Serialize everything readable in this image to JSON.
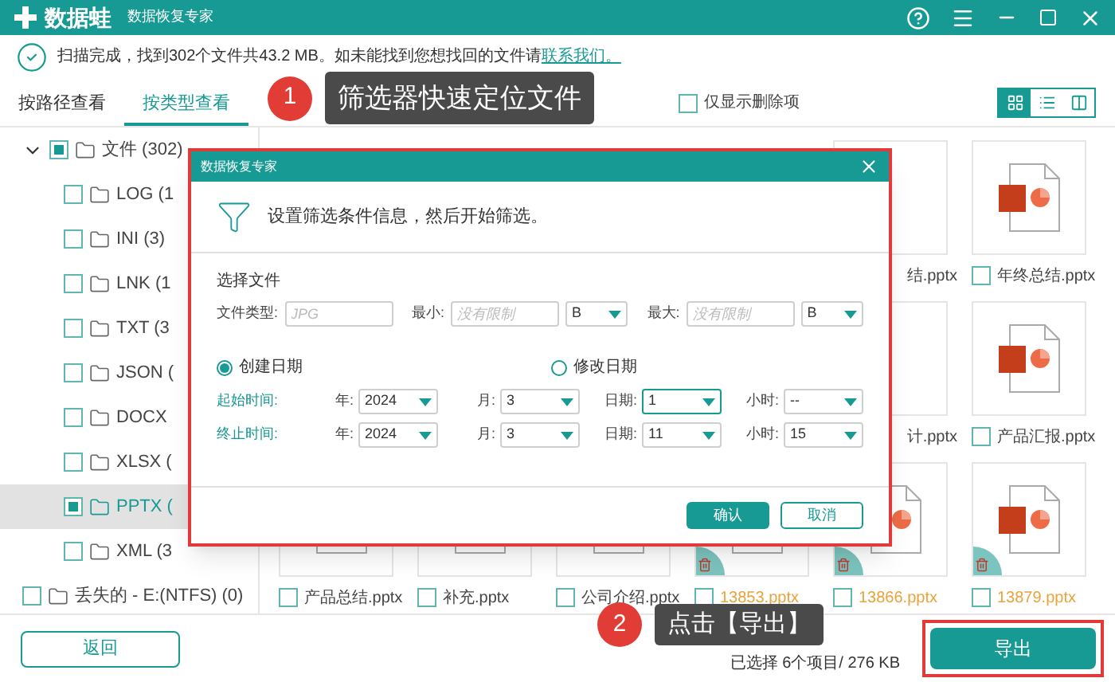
{
  "title_bar": {
    "logo_text": "数据蛙",
    "subtitle": "数据恢复专家"
  },
  "scan_status": {
    "text": "扫描完成，找到302个文件共43.2 MB。如未能找到您想找回的文件请",
    "link": "联系我们。"
  },
  "view_tabs": [
    {
      "label": "按路径查看",
      "selected": false
    },
    {
      "label": "按类型查看",
      "selected": true
    }
  ],
  "deleted_only": {
    "label": "仅显示删除项",
    "checked": false
  },
  "view_buttons": [
    {
      "kind": "grid",
      "selected": true
    },
    {
      "kind": "list",
      "selected": false
    },
    {
      "kind": "columns",
      "selected": false
    }
  ],
  "tree": [
    {
      "label": "文件 (302)",
      "partial": true,
      "expanded": true,
      "selected": false,
      "children": [
        {
          "label": "LOG (1",
          "partial": false,
          "selected": false
        },
        {
          "label": "INI (3)",
          "partial": false,
          "selected": false
        },
        {
          "label": "LNK (1",
          "partial": false,
          "selected": false
        },
        {
          "label": "TXT (3",
          "partial": false,
          "selected": false
        },
        {
          "label": "JSON (",
          "partial": false,
          "selected": false
        },
        {
          "label": "DOCX",
          "partial": false,
          "selected": false
        },
        {
          "label": "XLSX (",
          "partial": false,
          "selected": false
        },
        {
          "label": "PPTX (",
          "partial": true,
          "selected": true
        },
        {
          "label": "XML (3",
          "partial": false,
          "selected": false
        }
      ]
    },
    {
      "label": "丢失的 - E:(NTFS) (0)",
      "partial": false,
      "selected": false
    }
  ],
  "file_rows": [
    [
      {
        "name": "结.pptx",
        "deleted": false
      },
      {
        "name": "年终总结.pptx",
        "checked": false,
        "deleted": false
      }
    ],
    [
      {
        "name": "计.pptx",
        "deleted": false
      },
      {
        "name": "产品汇报.pptx",
        "checked": false,
        "deleted": false
      }
    ],
    [
      {
        "name": "产品总结.pptx",
        "checked": false,
        "deleted": false
      },
      {
        "name": "补充.pptx",
        "checked": false,
        "deleted": false
      },
      {
        "name": "公司介绍.pptx",
        "checked": false,
        "deleted": false
      },
      {
        "name": "13853.pptx",
        "checked": false,
        "deleted": true
      },
      {
        "name": "13866.pptx",
        "checked": false,
        "deleted": true
      },
      {
        "name": "13879.pptx",
        "checked": false,
        "deleted": true
      }
    ]
  ],
  "back_button": "返回",
  "selection_summary": "已选择 6个项目/ 276 KB",
  "export_button": "导出",
  "dialog": {
    "title": "数据恢复专家",
    "intro": "设置筛选条件信息，然后开始筛选。",
    "section": "选择文件",
    "file_type": {
      "label": "文件类型:",
      "placeholder": "JPG"
    },
    "min": {
      "label": "最小:",
      "placeholder": "没有限制",
      "unit": "B"
    },
    "max": {
      "label": "最大:",
      "placeholder": "没有限制",
      "unit": "B"
    },
    "date_modes": [
      {
        "label": "创建日期",
        "selected": true
      },
      {
        "label": "修改日期",
        "selected": false
      }
    ],
    "ranges": [
      {
        "label": "起始时间:",
        "fields": [
          {
            "label": "年:",
            "value": "2024",
            "focused": false
          },
          {
            "label": "月:",
            "value": "3",
            "focused": false
          },
          {
            "label": "日期:",
            "value": "1",
            "focused": true
          },
          {
            "label": "小时:",
            "value": "--",
            "focused": false
          }
        ]
      },
      {
        "label": "终止时间:",
        "fields": [
          {
            "label": "年:",
            "value": "2024",
            "focused": false
          },
          {
            "label": "月:",
            "value": "3",
            "focused": false
          },
          {
            "label": "日期:",
            "value": "11",
            "focused": false
          },
          {
            "label": "小时:",
            "value": "15",
            "focused": false
          }
        ]
      }
    ],
    "buttons": [
      {
        "label": "确认",
        "kind": "primary"
      },
      {
        "label": "取消",
        "kind": "secondary"
      }
    ]
  },
  "annotations": [
    {
      "number": "1",
      "text": "筛选器快速定位文件"
    },
    {
      "number": "2",
      "text": "点击【导出】"
    }
  ]
}
